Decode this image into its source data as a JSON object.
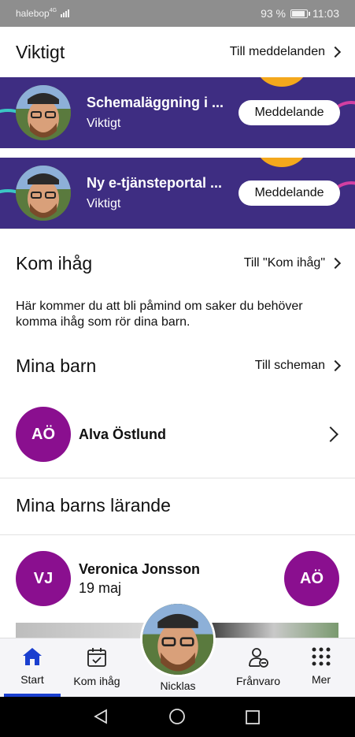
{
  "status_bar": {
    "carrier": "halebop",
    "network": "4G",
    "battery": "93 %",
    "time": "11:03"
  },
  "viktigt": {
    "title": "Viktigt",
    "link": "Till meddelanden",
    "banners": [
      {
        "title": "Schemaläggning i ...",
        "subtitle": "Viktigt",
        "button": "Meddelande"
      },
      {
        "title": "Ny e-tjänsteportal ...",
        "subtitle": "Viktigt",
        "button": "Meddelande"
      }
    ]
  },
  "kom_ihag": {
    "title": "Kom ihåg",
    "link": "Till \"Kom ihåg\"",
    "text": "Här kommer du att bli påmind om saker du behöver komma ihåg som rör dina barn."
  },
  "mina_barn": {
    "title": "Mina barn",
    "link": "Till scheman",
    "children": [
      {
        "initials": "AÖ",
        "name": "Alva Östlund"
      }
    ]
  },
  "larande": {
    "title": "Mina barns lärande",
    "post": {
      "author_initials": "VJ",
      "author": "Veronica Jonsson",
      "date": "19 maj",
      "child_initials": "AÖ"
    }
  },
  "tabbar": {
    "tabs": [
      {
        "label": "Start",
        "icon": "home-icon",
        "active": true
      },
      {
        "label": "Kom ihåg",
        "icon": "calendar-check-icon",
        "active": false
      },
      {
        "label": "Nicklas",
        "icon": "profile-avatar",
        "active": false
      },
      {
        "label": "Frånvaro",
        "icon": "person-absence-icon",
        "active": false
      },
      {
        "label": "Mer",
        "icon": "grid-dots-icon",
        "active": false
      }
    ]
  },
  "colors": {
    "banner_bg": "#3e2d82",
    "avatar_bg": "#8a0f8f",
    "active_tab": "#1a3fcf",
    "accent_orange": "#f4a81c"
  }
}
